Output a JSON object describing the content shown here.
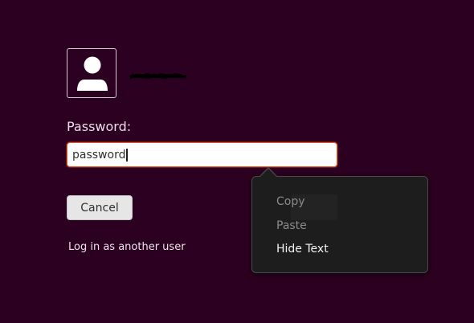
{
  "login": {
    "password_label": "Password:",
    "password_value": "password",
    "cancel_label": "Cancel",
    "other_user_label": "Log in as another user"
  },
  "context_menu": {
    "items": [
      {
        "label": "Copy",
        "enabled": false
      },
      {
        "label": "Paste",
        "enabled": false
      },
      {
        "label": "Hide Text",
        "enabled": true
      }
    ]
  },
  "colors": {
    "background": "#2c0020",
    "focus_accent": "#e95420",
    "menu_background": "#1d1d1d"
  },
  "icons": {
    "avatar": "user-icon"
  }
}
